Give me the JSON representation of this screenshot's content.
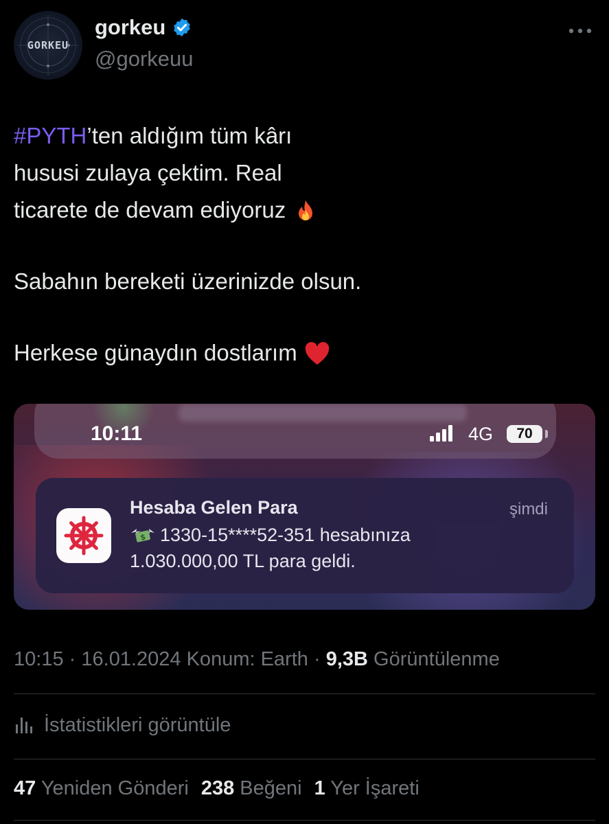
{
  "author": {
    "display_name": "gorkeu",
    "handle": "@gorkeuu",
    "avatar_text": "GORKEU",
    "verified": true
  },
  "tweet": {
    "hashtag": "#PYTH",
    "line1_rest": "’ten aldığım tüm kârı",
    "line2": "hususi zulaya çektim. Real",
    "line3": "ticarete de devam ediyoruz",
    "para2": "Sabahın bereketi üzerinizde olsun.",
    "para3": "Herkese günaydın dostlarım",
    "emoji_fire": "fire-emoji",
    "emoji_heart": "red-heart-emoji"
  },
  "media": {
    "status_time": "10:11",
    "network": "4G",
    "battery": "70",
    "notification": {
      "title": "Hesaba Gelen Para",
      "time": "şimdi",
      "body_line1": "1330-15****52-351 hesabınıza",
      "body_line2": "1.030.000,00 TL para geldi.",
      "app_icon": "ship-wheel-icon"
    }
  },
  "meta": {
    "time": "10:15",
    "sep1": "·",
    "date": "16.01.2024",
    "location": "Konum: Earth",
    "sep2": "·",
    "views": "9,3B",
    "views_label": "Görüntülenme"
  },
  "stats_link": "İstatistikleri görüntüle",
  "counts": {
    "reposts": "47",
    "reposts_label": "Yeniden Gönderi",
    "likes": "238",
    "likes_label": "Beğeni",
    "bookmarks": "1",
    "bookmarks_label": "Yer İşareti"
  },
  "colors": {
    "background": "#000000",
    "text": "#e7e9ea",
    "muted": "#71767b",
    "hashtag": "#7c5cf0",
    "verified": "#1d9bf0"
  }
}
